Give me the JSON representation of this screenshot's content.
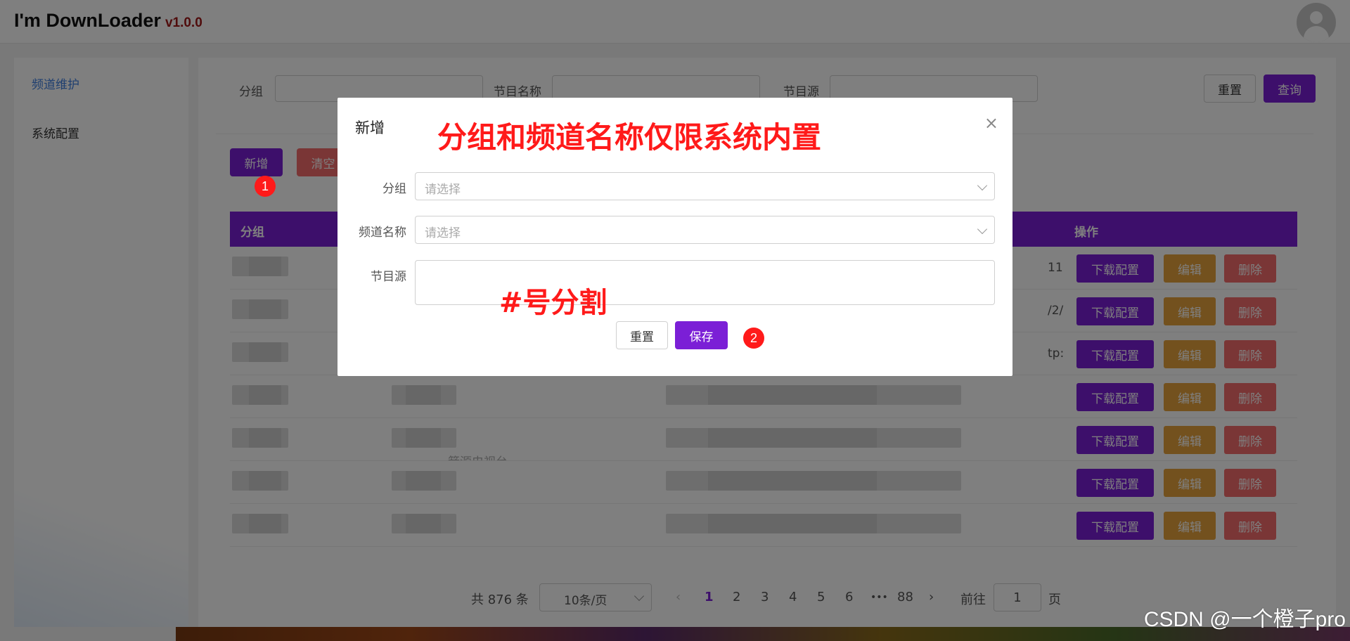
{
  "app": {
    "title": "I'm DownLoader",
    "version": "v1.0.0"
  },
  "sidebar": {
    "items": [
      {
        "label": "频道维护"
      },
      {
        "label": "系统配置"
      }
    ]
  },
  "filters": {
    "group_label": "分组",
    "name_label": "节目名称",
    "source_label": "节目源",
    "reset_label": "重置",
    "search_label": "查询"
  },
  "toolbar": {
    "add_label": "新增",
    "clear_label": "清空"
  },
  "table": {
    "headers": {
      "group": "分组",
      "actions": "操作"
    },
    "row_actions": {
      "download": "下载配置",
      "edit": "编辑",
      "delete": "删除"
    },
    "partial_cells": [
      "11",
      "/2/",
      "tp:",
      "",
      "",
      "",
      ""
    ],
    "partial_name": "箭源电视台"
  },
  "pagination": {
    "total": "共 876 条",
    "page_size": "10条/页",
    "pages": [
      "1",
      "2",
      "3",
      "4",
      "5",
      "6"
    ],
    "ellipsis": "•••",
    "last_page": "88",
    "goto_label": "前往",
    "goto_value": "1",
    "page_suffix": "页",
    "prev": "‹",
    "next": "›"
  },
  "dialog": {
    "title": "新增",
    "close": "×",
    "fields": {
      "group_label": "分组",
      "group_placeholder": "请选择",
      "channel_label": "频道名称",
      "channel_placeholder": "请选择",
      "source_label": "节目源"
    },
    "reset_label": "重置",
    "save_label": "保存"
  },
  "annotations": {
    "heading": "分组和频道名称仅限系统内置",
    "source_hint": "#号分割",
    "step1": "1",
    "step2": "2",
    "color": "#ff1a1a"
  },
  "watermark": "CSDN @一个橙子pro",
  "colors": {
    "accent": "#7b1fd6",
    "danger": "#f56c6c",
    "warning": "#e6a23c",
    "link": "#3f7fe0"
  }
}
